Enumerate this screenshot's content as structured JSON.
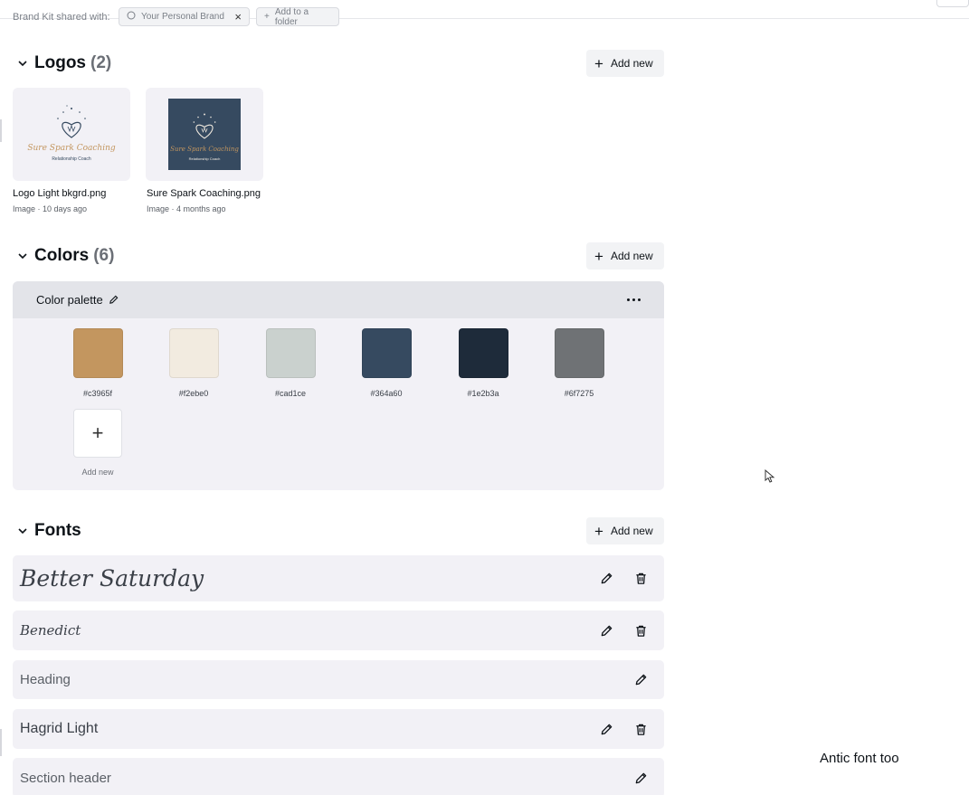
{
  "topbar": {
    "share_label": "Brand Kit shared with:",
    "chip_brand": "Your Personal Brand",
    "chip_folder": "Add to a folder"
  },
  "logos": {
    "title": "Logos",
    "count": "(2)",
    "add_label": "Add new",
    "items": [
      {
        "name": "Logo Light bkgrd.png",
        "meta": "Image · 10 days ago",
        "logo_line1": "Sure Spark Coaching",
        "logo_line2": "Relationship Coach"
      },
      {
        "name": "Sure Spark Coaching.png",
        "meta": "Image · 4 months ago",
        "logo_line1": "Sure Spark Coaching",
        "logo_line2": "Relationship Coach"
      }
    ]
  },
  "colors": {
    "title": "Colors",
    "count": "(6)",
    "add_label": "Add new",
    "palette_title": "Color palette",
    "swatches": [
      {
        "hex": "#c3965f"
      },
      {
        "hex": "#f2ebe0"
      },
      {
        "hex": "#cad1ce"
      },
      {
        "hex": "#364a60"
      },
      {
        "hex": "#1e2b3a"
      },
      {
        "hex": "#6f7275"
      }
    ],
    "add_swatch_label": "Add new"
  },
  "fonts": {
    "title": "Fonts",
    "add_label": "Add new",
    "rows": [
      {
        "sample": "Better Saturday"
      },
      {
        "sample": "Benedict"
      },
      {
        "sample": "Heading"
      },
      {
        "sample": "Hagrid Light"
      },
      {
        "sample": "Section header"
      }
    ]
  },
  "note": "Antic font too"
}
